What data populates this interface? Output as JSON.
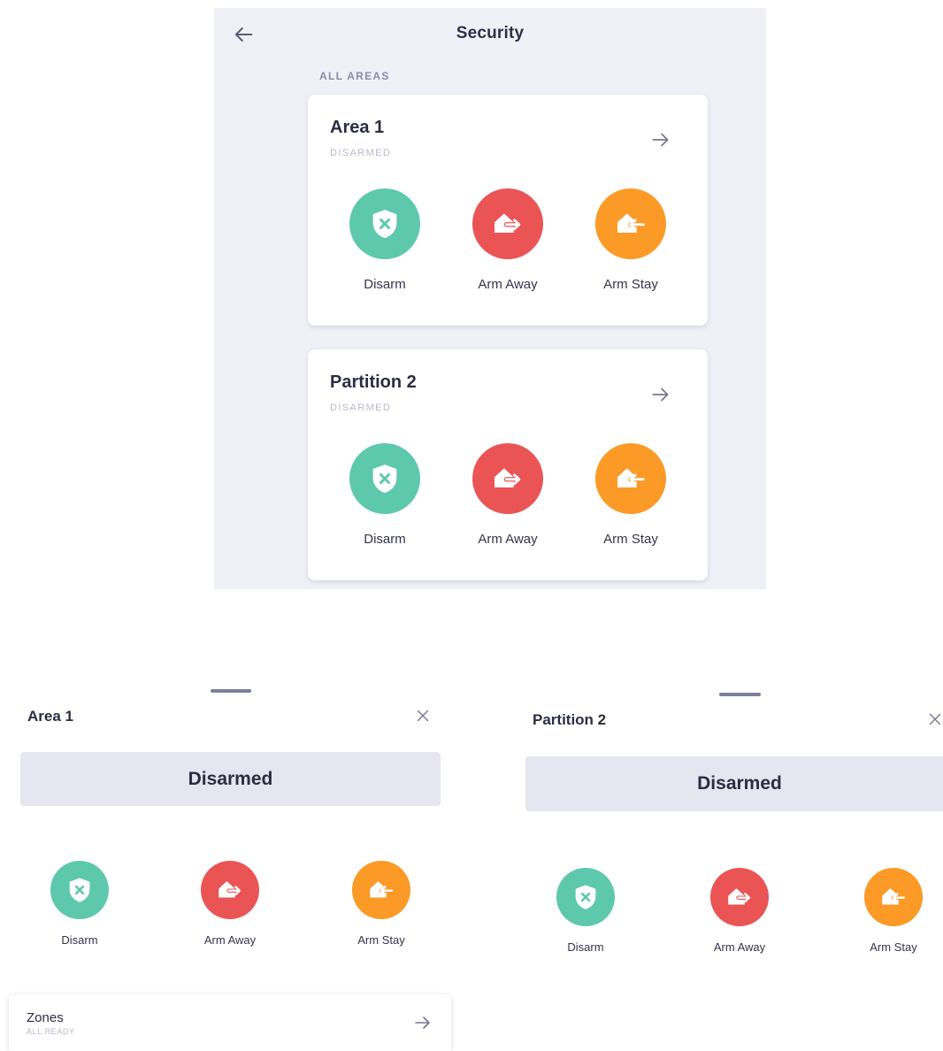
{
  "main": {
    "title": "Security",
    "section_label": "ALL AREAS",
    "cards": [
      {
        "title": "Area 1",
        "status": "DISARMED",
        "actions": [
          {
            "label": "Disarm",
            "icon": "shield-x-icon",
            "color": "#5ec8ad"
          },
          {
            "label": "Arm Away",
            "icon": "home-exit-icon",
            "color": "#ea5455"
          },
          {
            "label": "Arm Stay",
            "icon": "home-enter-icon",
            "color": "#fb9a27"
          }
        ]
      },
      {
        "title": "Partition 2",
        "status": "DISARMED",
        "actions": [
          {
            "label": "Disarm",
            "icon": "shield-x-icon",
            "color": "#5ec8ad"
          },
          {
            "label": "Arm Away",
            "icon": "home-exit-icon",
            "color": "#ea5455"
          },
          {
            "label": "Arm Stay",
            "icon": "home-enter-icon",
            "color": "#fb9a27"
          }
        ]
      }
    ]
  },
  "sheets": [
    {
      "title": "Area 1",
      "status": "Disarmed",
      "actions": [
        {
          "label": "Disarm"
        },
        {
          "label": "Arm Away"
        },
        {
          "label": "Arm Stay"
        }
      ],
      "zones": {
        "title": "Zones",
        "subtitle": "ALL READY"
      }
    },
    {
      "title": "Partition 2",
      "status": "Disarmed",
      "actions": [
        {
          "label": "Disarm"
        },
        {
          "label": "Arm Away"
        },
        {
          "label": "Arm Stay"
        }
      ]
    }
  ],
  "colors": {
    "disarm": "#5ec8ad",
    "arm_away": "#ea5455",
    "arm_stay": "#fb9a27",
    "screen_bg": "#f0f1f7",
    "status_bar_bg": "#e6e6f1"
  }
}
